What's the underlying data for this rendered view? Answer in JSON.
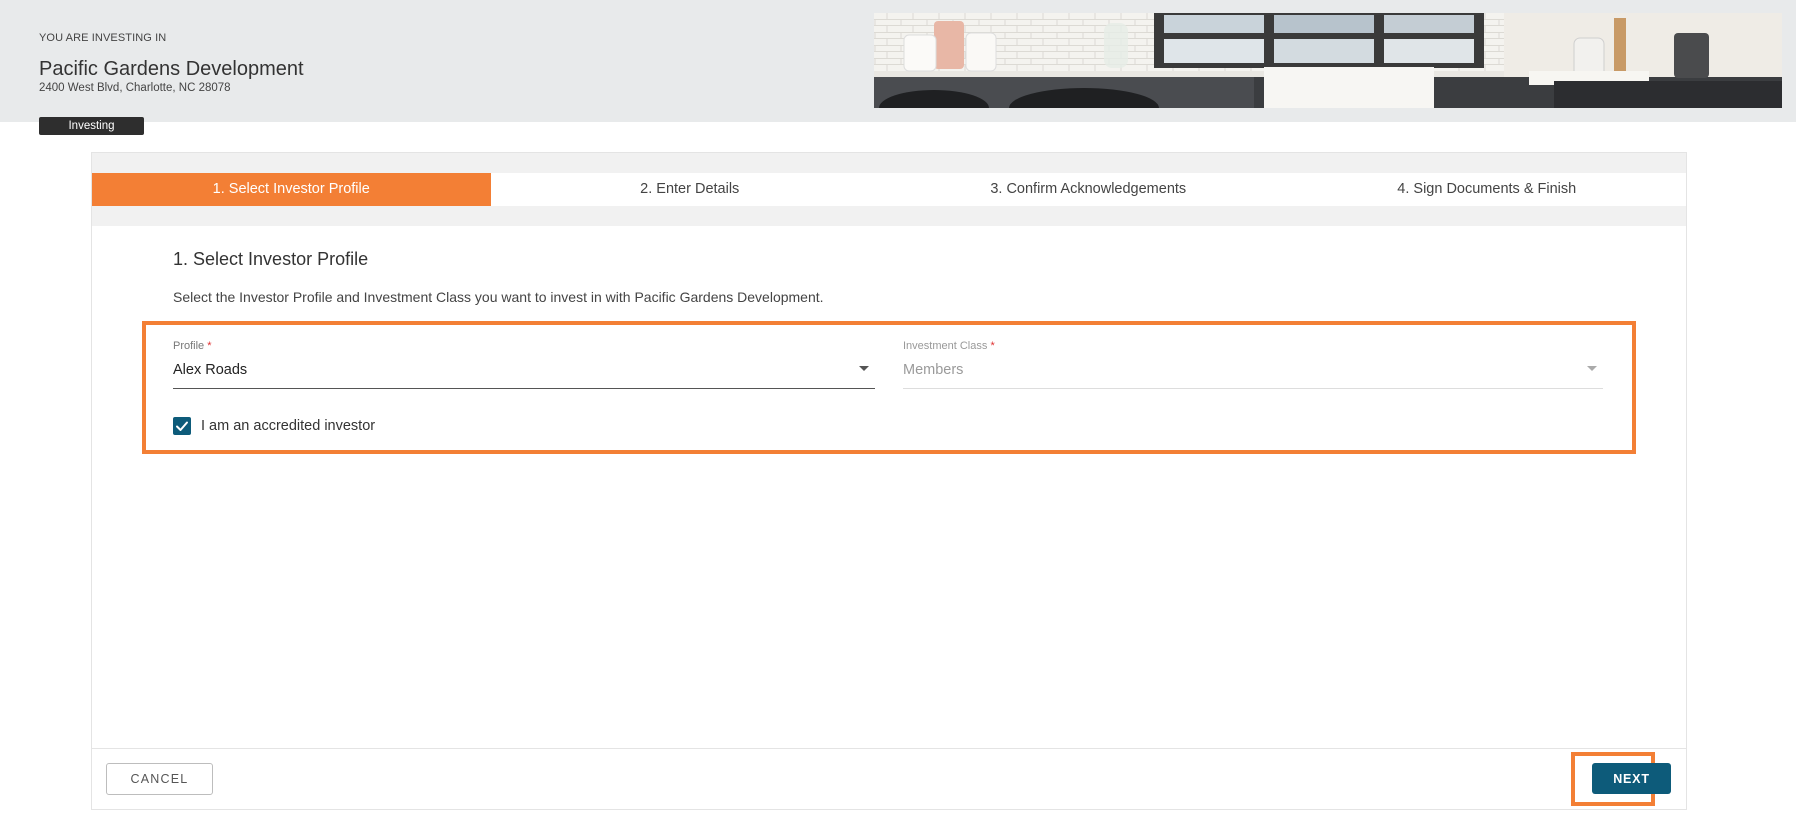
{
  "header": {
    "eyebrow": "YOU ARE INVESTING IN",
    "property_name": "Pacific Gardens Development",
    "address": "2400 West Blvd, Charlotte, NC 28078",
    "status": "Investing",
    "hero_image": "kitchen-photo"
  },
  "stepper": {
    "steps": [
      {
        "label": "1. Select Investor Profile",
        "active": true
      },
      {
        "label": "2. Enter Details",
        "active": false
      },
      {
        "label": "3. Confirm Acknowledgements",
        "active": false
      },
      {
        "label": "4. Sign Documents & Finish",
        "active": false
      }
    ]
  },
  "form": {
    "title": "1. Select Investor Profile",
    "description": "Select the Investor Profile and Investment Class you want to invest in with Pacific Gardens Development.",
    "profile": {
      "label": "Profile",
      "required_mark": "*",
      "value": "Alex Roads"
    },
    "investment_class": {
      "label": "Investment Class",
      "required_mark": "*",
      "value": "Members",
      "disabled": true
    },
    "accredited": {
      "label": "I am an accredited investor",
      "checked": true
    }
  },
  "footer": {
    "cancel_label": "CANCEL",
    "next_label": "NEXT"
  },
  "colors": {
    "accent": "#f37f35",
    "primary": "#0d5b7a",
    "badge": "#2e2e2e"
  }
}
